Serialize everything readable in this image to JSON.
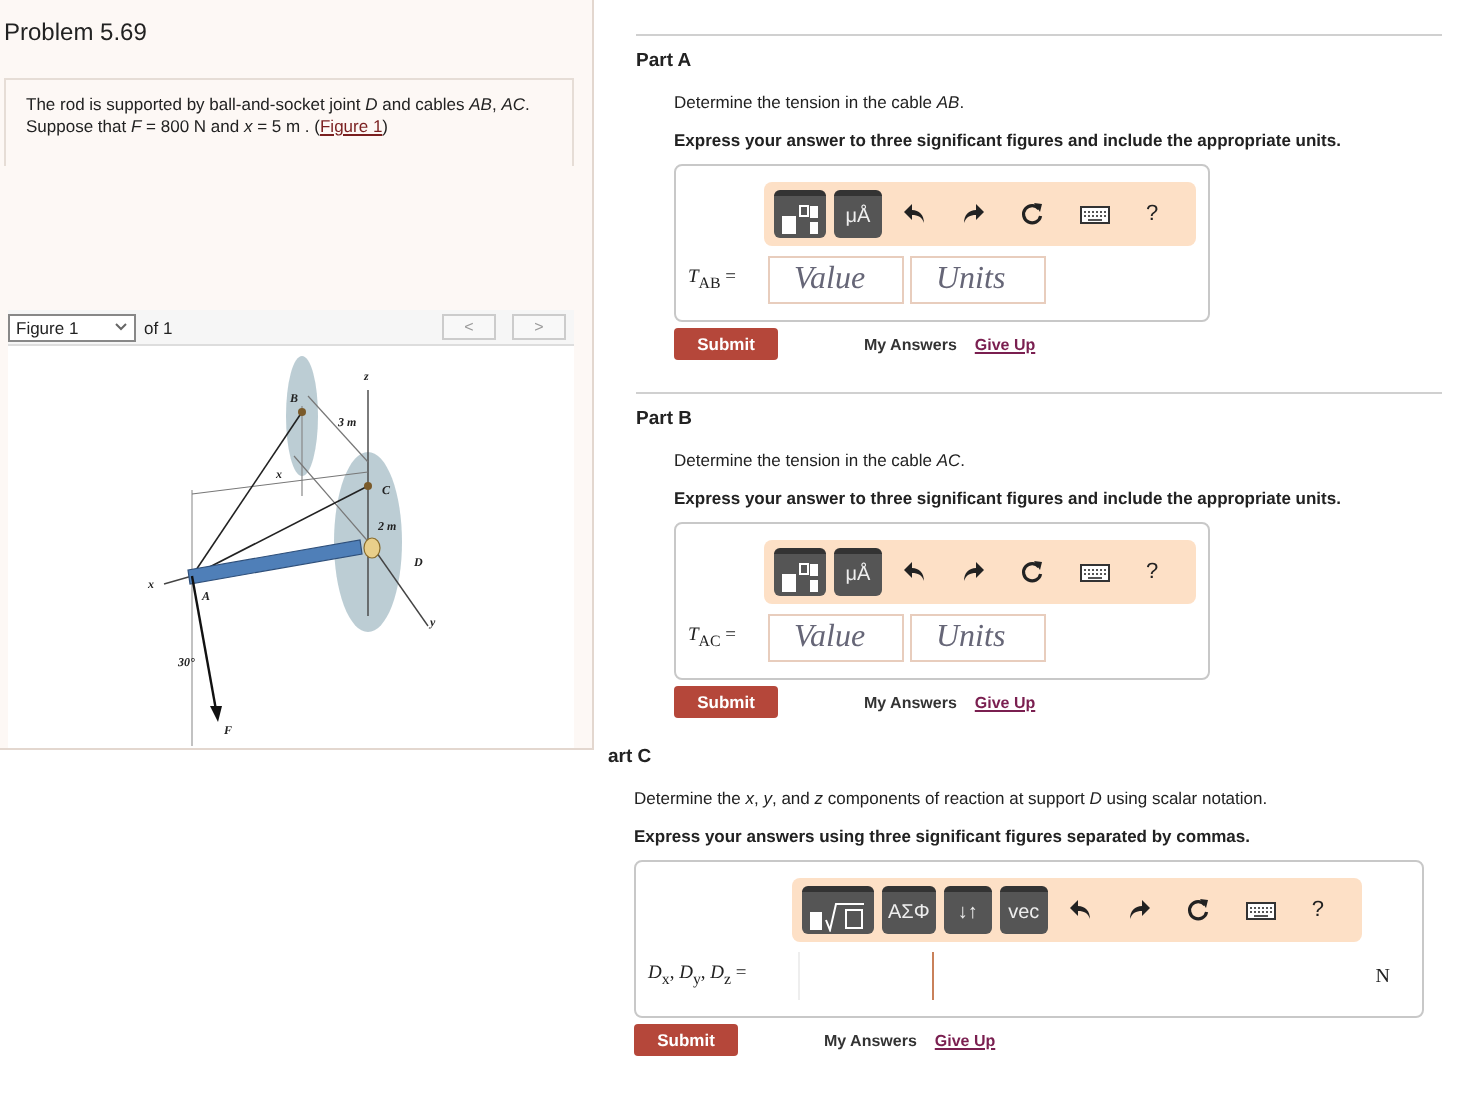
{
  "problem": {
    "title": "Problem 5.69",
    "statement": "The rod is supported by ball-and-socket joint *D* and cables *AB*, *AC*. Suppose that *F* = 800 N and *x* = 5 m . (",
    "link": "Figure 1",
    "after": ")"
  },
  "figure": {
    "selector": "Figure 1",
    "of": "of 1",
    "prev": "<",
    "next": ">",
    "labels": [
      "B",
      "3 m",
      "z",
      "x",
      "C",
      "2 m",
      "D",
      "x",
      "A",
      "y",
      "30°",
      "F"
    ]
  },
  "parts": [
    {
      "title": "Part A",
      "kind": "value-units",
      "question": "Determine the tension in the cable *AB*.",
      "instruction": "Express your answer to three significant figures and include the appropriate units.",
      "toolbar": [
        {
          "kind": "templates"
        },
        {
          "kind": "symbol",
          "label": "μÅ"
        },
        {
          "kind": "undo"
        },
        {
          "kind": "redo"
        },
        {
          "kind": "reset"
        },
        {
          "kind": "keyboard"
        },
        {
          "kind": "help",
          "label": "?"
        }
      ],
      "answer_label": "*T*$_{AB}$ =",
      "value_placeholder": "Value",
      "units_placeholder": "Units",
      "submit": "Submit",
      "my_answers": "My Answers",
      "give_up": "Give Up"
    },
    {
      "title": "Part B",
      "kind": "value-units",
      "question": "Determine the tension in the cable *AC*.",
      "instruction": "Express your answer to three significant figures and include the appropriate units.",
      "toolbar": [
        {
          "kind": "templates"
        },
        {
          "kind": "symbol",
          "label": "μÅ"
        },
        {
          "kind": "undo"
        },
        {
          "kind": "redo"
        },
        {
          "kind": "reset"
        },
        {
          "kind": "keyboard"
        },
        {
          "kind": "help",
          "label": "?"
        }
      ],
      "answer_label": "*T*$_{AC}$ =",
      "value_placeholder": "Value",
      "units_placeholder": "Units",
      "submit": "Submit",
      "my_answers": "My Answers",
      "give_up": "Give Up"
    },
    {
      "title": "art C",
      "kind": "vector",
      "question": "Determine the *x*, *y*, and *z* components of reaction at support *D* using scalar notation.",
      "instruction": "Express your answers using three significant figures separated by commas.",
      "toolbar": [
        {
          "kind": "root-templates"
        },
        {
          "kind": "symbol",
          "label": "ΑΣΦ"
        },
        {
          "kind": "symbol",
          "label": "↓↑"
        },
        {
          "kind": "symbol",
          "label": "vec"
        },
        {
          "kind": "undo"
        },
        {
          "kind": "redo"
        },
        {
          "kind": "reset"
        },
        {
          "kind": "keyboard"
        },
        {
          "kind": "help",
          "label": "?"
        }
      ],
      "answer_label": "*D*$_{x}$, *D*$_{y}$, *D*$_{z}$ =",
      "unit": "N",
      "submit": "Submit",
      "my_answers": "My Answers",
      "give_up": "Give Up"
    }
  ]
}
